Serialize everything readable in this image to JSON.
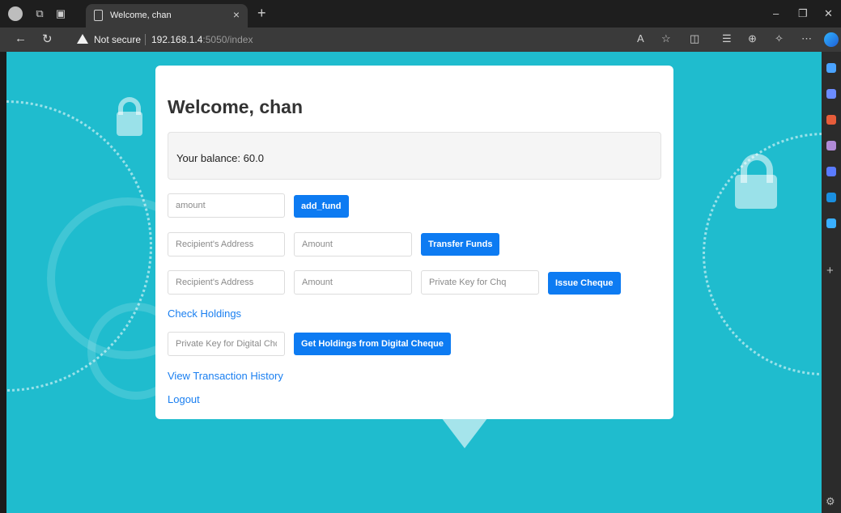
{
  "browser": {
    "tab_title": "Welcome, chan",
    "tab_close": "×",
    "new_tab": "+",
    "security_label": "Not secure",
    "url_host": "192.168.1.4",
    "url_path": ":5050/index",
    "window_controls": {
      "minimize": "–",
      "restore": "❐",
      "close": "✕"
    },
    "icons": [
      "back-icon",
      "refresh-icon",
      "warning-icon",
      "read-aloud-icon",
      "favorite-icon",
      "split-screen-icon",
      "favorites-icon",
      "collections-icon",
      "extensions-icon",
      "more-icon",
      "copilot-icon"
    ]
  },
  "page": {
    "heading": "Welcome, chan",
    "balance_text": "Your balance: 60.0",
    "add_fund": {
      "placeholder": "amount",
      "button": "add_fund"
    },
    "transfer": {
      "recipient_placeholder": "Recipient's Address",
      "amount_placeholder": "Amount",
      "button": "Transfer Funds"
    },
    "cheque": {
      "recipient_placeholder": "Recipient's Address",
      "amount_placeholder": "Amount",
      "key_placeholder": "Private Key for Chq",
      "button": "Issue Cheque"
    },
    "check_holdings_link": "Check Holdings",
    "digital_cheque": {
      "key_placeholder": "Private Key for Digital Chq",
      "button": "Get Holdings from Digital Cheque"
    },
    "history_link": "View Transaction History",
    "logout_link": "Logout"
  },
  "colors": {
    "background": "#1fbcce",
    "primary_button": "#0d7bf2",
    "link": "#1a7ff0"
  }
}
